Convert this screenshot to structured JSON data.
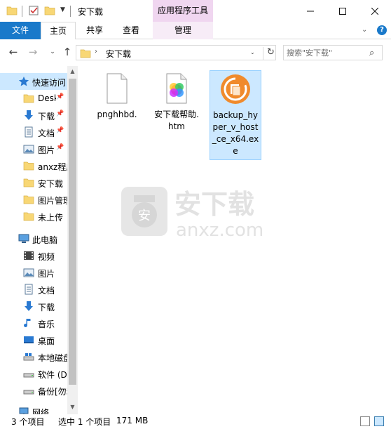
{
  "window": {
    "title": "安下载",
    "context_tab_title": "应用程序工具",
    "min_icon": "minimize-icon",
    "max_icon": "maximize-icon",
    "close_icon": "close-icon"
  },
  "ribbon": {
    "tabs": [
      {
        "label": "文件"
      },
      {
        "label": "主页"
      },
      {
        "label": "共享"
      },
      {
        "label": "查看"
      },
      {
        "label": "管理"
      }
    ],
    "accent": "#1979ca",
    "help_label": "?"
  },
  "navigation": {
    "path": "安下载",
    "search_placeholder": "搜索\"安下载\""
  },
  "sidebar": {
    "quick_access_label": "快速访问",
    "quick_access_items": [
      {
        "label": "Desktop",
        "icon": "folder-blue-icon",
        "pinned": true
      },
      {
        "label": "下载",
        "icon": "download-arrow-icon",
        "pinned": true
      },
      {
        "label": "文档",
        "icon": "document-icon",
        "pinned": true
      },
      {
        "label": "图片",
        "icon": "picture-icon",
        "pinned": true
      },
      {
        "label": "anxz程序",
        "icon": "folder-icon",
        "pinned": false
      },
      {
        "label": "安下载",
        "icon": "folder-icon",
        "pinned": false
      },
      {
        "label": "图片管理",
        "icon": "folder-icon",
        "pinned": false
      },
      {
        "label": "未上传",
        "icon": "folder-icon",
        "pinned": false
      }
    ],
    "this_pc_label": "此电脑",
    "this_pc_items": [
      {
        "label": "视频",
        "icon": "video-icon"
      },
      {
        "label": "图片",
        "icon": "picture-icon"
      },
      {
        "label": "文档",
        "icon": "document-icon"
      },
      {
        "label": "下载",
        "icon": "download-arrow-icon"
      },
      {
        "label": "音乐",
        "icon": "music-icon"
      },
      {
        "label": "桌面",
        "icon": "desktop-icon"
      },
      {
        "label": "本地磁盘 (C:)",
        "icon": "drive-icon"
      },
      {
        "label": "软件 (D:)",
        "icon": "drive-icon"
      },
      {
        "label": "备份[勿动] (E:)",
        "icon": "drive-icon"
      }
    ],
    "network_label": "网络"
  },
  "files": [
    {
      "name": "pnghhbd.",
      "icon": "blank-file-icon",
      "selected": false
    },
    {
      "name": "安下载帮助.htm",
      "icon": "htm-file-icon",
      "selected": false
    },
    {
      "name": "backup_hyper_v_host_ce_x64.exe",
      "icon": "backup-exe-icon",
      "selected": true
    }
  ],
  "watermark": {
    "text_cn": "安下载",
    "text_en": "anxz.com"
  },
  "status": {
    "count": "3 个项目",
    "selected": "选中 1 个项目",
    "size": "171 MB"
  }
}
